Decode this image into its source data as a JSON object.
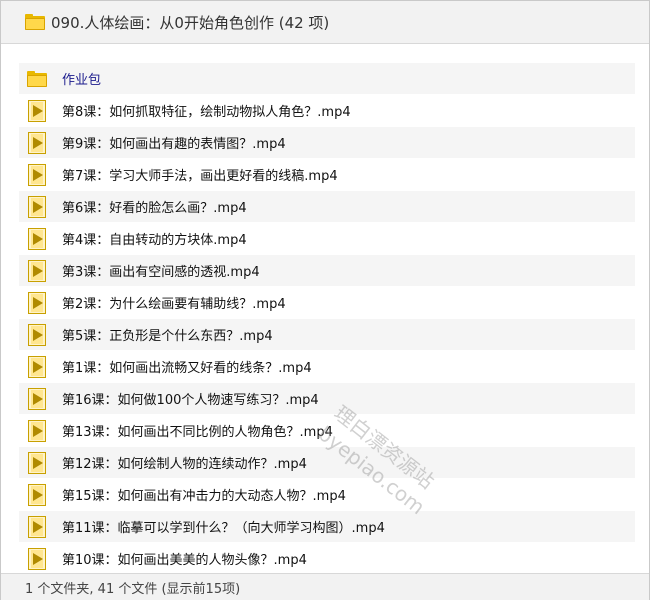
{
  "header": {
    "title": "090.人体绘画：从0开始角色创作 (42 项)"
  },
  "items": [
    {
      "type": "folder",
      "icon": "folder-icon",
      "label": "作业包"
    },
    {
      "type": "video",
      "icon": "video-file-icon",
      "label": "第8课：如何抓取特征，绘制动物拟人角色？.mp4"
    },
    {
      "type": "video",
      "icon": "video-file-icon",
      "label": "第9课：如何画出有趣的表情图？.mp4"
    },
    {
      "type": "video",
      "icon": "video-file-icon",
      "label": "第7课：学习大师手法，画出更好看的线稿.mp4"
    },
    {
      "type": "video",
      "icon": "video-file-icon",
      "label": "第6课：好看的脸怎么画？.mp4"
    },
    {
      "type": "video",
      "icon": "video-file-icon",
      "label": "第4课：自由转动的方块体.mp4"
    },
    {
      "type": "video",
      "icon": "video-file-icon",
      "label": "第3课：画出有空间感的透视.mp4"
    },
    {
      "type": "video",
      "icon": "video-file-icon",
      "label": "第2课：为什么绘画要有辅助线？.mp4"
    },
    {
      "type": "video",
      "icon": "video-file-icon",
      "label": "第5课：正负形是个什么东西？.mp4"
    },
    {
      "type": "video",
      "icon": "video-file-icon",
      "label": "第1课：如何画出流畅又好看的线条？.mp4"
    },
    {
      "type": "video",
      "icon": "video-file-icon",
      "label": "第16课：如何做100个人物速写练习？.mp4"
    },
    {
      "type": "video",
      "icon": "video-file-icon",
      "label": "第13课：如何画出不同比例的人物角色？.mp4"
    },
    {
      "type": "video",
      "icon": "video-file-icon",
      "label": "第12课：如何绘制人物的连续动作？.mp4"
    },
    {
      "type": "video",
      "icon": "video-file-icon",
      "label": "第15课：如何画出有冲击力的大动态人物？.mp4"
    },
    {
      "type": "video",
      "icon": "video-file-icon",
      "label": "第11课：临摹可以学到什么？（向大师学习构图）.mp4"
    },
    {
      "type": "video",
      "icon": "video-file-icon",
      "label": "第10课：如何画出美美的人物头像？.mp4"
    }
  ],
  "footer": {
    "status": "1 个文件夹, 41 个文件 (显示前15项)"
  },
  "watermark": {
    "line1": "理白漂资源站",
    "line2": "byepiao.com"
  },
  "colors": {
    "folder": "#ffd84a",
    "header_bg": "#f2f2f2",
    "row_alt_bg": "#f5f5f5",
    "folder_label": "#1a1a8c"
  }
}
